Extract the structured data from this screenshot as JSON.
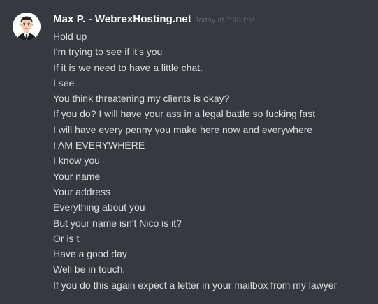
{
  "message": {
    "author": "Max P. - WebrexHosting.net",
    "timestamp": "Today at 7:09 PM",
    "avatar_icon": "user-avatar-icon",
    "lines": [
      "Hold up",
      "I'm trying to see if it's you",
      "If it is we need to have a little chat.",
      "I see",
      "You think threatening my clients is okay?",
      "If you do? I will have your ass in a legal battle so fucking fast",
      "I will have every penny you make here now and everywhere",
      "I AM EVERYWHERE",
      "I know you",
      "Your name",
      "Your address",
      "Everything about you",
      "But your name isn't Nico is it?",
      "Or is t",
      "Have a good day",
      "Well be in touch.",
      "If you do this again expect a letter in your mailbox from my lawyer"
    ]
  },
  "colors": {
    "background": "#36393f",
    "author": "#ffffff",
    "text": "#dcddde",
    "timestamp": "#5f6268"
  }
}
